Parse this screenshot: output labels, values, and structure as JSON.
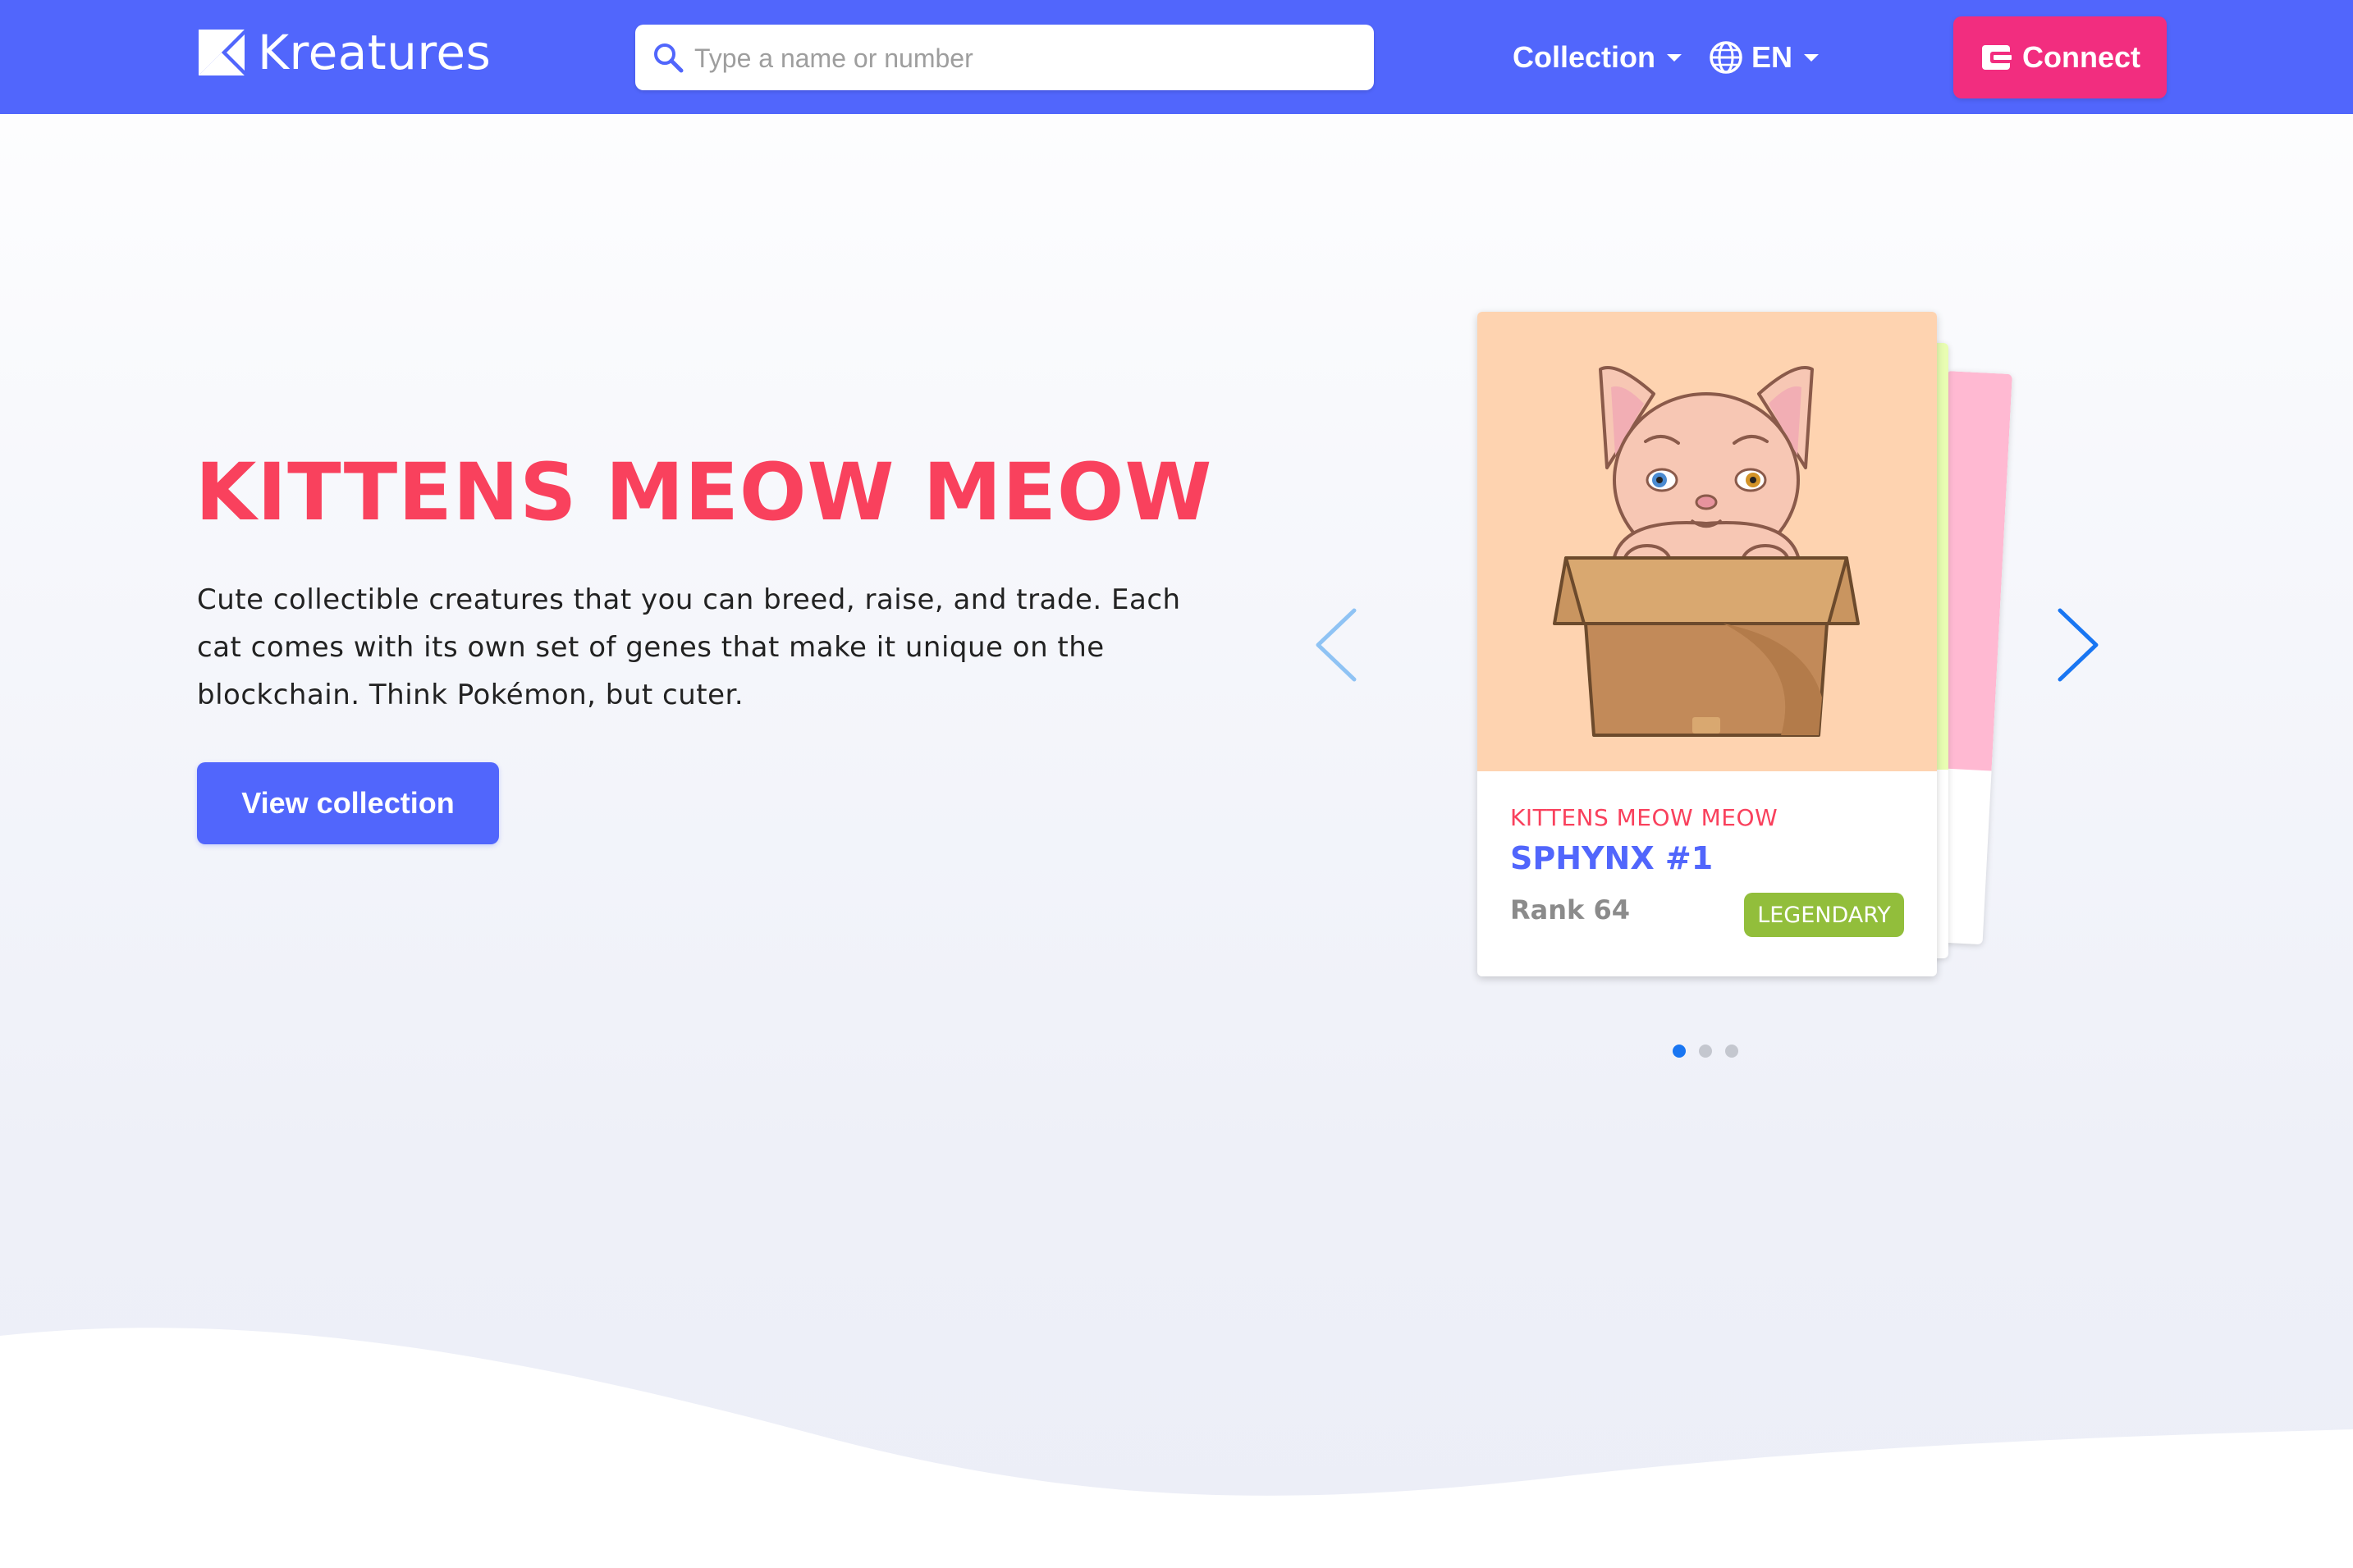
{
  "brand": {
    "name": "Kreatures"
  },
  "search": {
    "placeholder": "Type a name or number"
  },
  "nav": {
    "collection_label": "Collection",
    "language_label": "EN",
    "connect_label": "Connect"
  },
  "hero": {
    "title": "KITTENS MEOW MEOW",
    "description": "Cute collectible creatures that you can breed, raise, and trade. Each cat comes with its own set of genes that make it unique on the blockchain. Think Pokémon, but cuter.",
    "cta_label": "View collection"
  },
  "carousel": {
    "active_index": 0,
    "slide_count": 3,
    "card": {
      "collection": "KITTENS MEOW MEOW",
      "name": "SPHYNX #1",
      "rank": "Rank 64",
      "rarity": "LEGENDARY",
      "image_bg": "#fed3b0",
      "rarity_color": "#92be3b"
    },
    "stacked_card_colors": [
      "#e8fdb2",
      "#ffb9d2"
    ]
  },
  "colors": {
    "primary": "#5166fc",
    "accent_pink": "#f22d7f",
    "title_red": "#f9415d",
    "dot_active": "#1976f2"
  }
}
